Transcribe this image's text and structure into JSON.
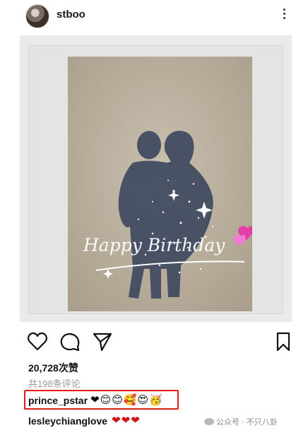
{
  "header": {
    "username": "stboo"
  },
  "photo": {
    "caption_text": "Happy Birthday"
  },
  "actions": {
    "like_icon": "heart-outline-icon",
    "comment_icon": "comment-bubble-icon",
    "share_icon": "paper-plane-icon",
    "save_icon": "bookmark-icon"
  },
  "stats": {
    "likes": "20,728次赞",
    "comments_link": "共198条评论"
  },
  "comments": [
    {
      "user": "prince_pstar",
      "text": "❤😊😊🥰😍🥳"
    },
    {
      "user": "lesleychianglove",
      "text": "❤❤❤"
    }
  ],
  "watermark": {
    "text": "公众号 · 不只八卦"
  },
  "colors": {
    "highlight_border": "#e01919",
    "heart_red": "#d01515"
  }
}
